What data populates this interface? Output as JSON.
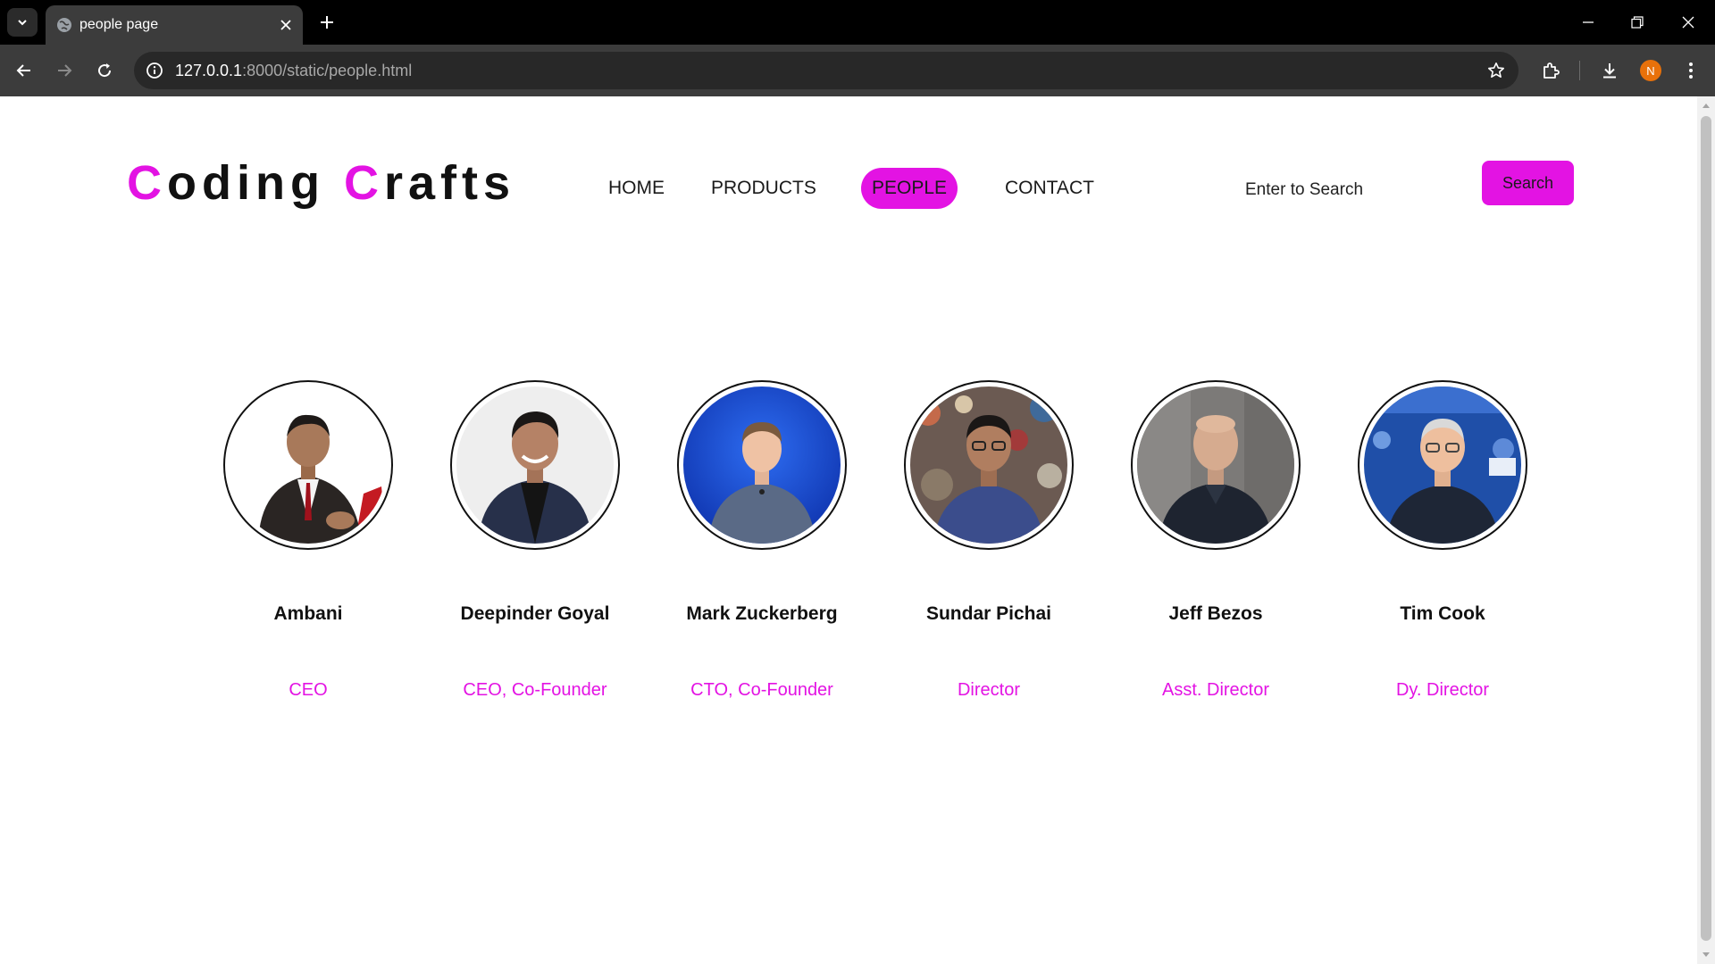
{
  "browser": {
    "tab_title": "people page",
    "url_host": "127.0.0.1",
    "url_rest": ":8000/static/people.html",
    "profile_initial": "N",
    "accent_color": "#e313e3"
  },
  "header": {
    "logo_c1": "C",
    "logo_w1": "oding",
    "logo_c2": "C",
    "logo_w2": "rafts"
  },
  "nav": {
    "items": [
      {
        "label": "HOME",
        "active": false
      },
      {
        "label": "PRODUCTS",
        "active": false
      },
      {
        "label": "PEOPLE",
        "active": true
      },
      {
        "label": "CONTACT",
        "active": false
      }
    ]
  },
  "search": {
    "placeholder": "Enter to Search",
    "button_label": "Search"
  },
  "people": [
    {
      "name": "Ambani",
      "role": "CEO"
    },
    {
      "name": "Deepinder Goyal",
      "role": "CEO, Co-Founder"
    },
    {
      "name": "Mark Zuckerberg",
      "role": "CTO, Co-Founder"
    },
    {
      "name": "Sundar Pichai",
      "role": "Director"
    },
    {
      "name": "Jeff Bezos",
      "role": "Asst. Director"
    },
    {
      "name": "Tim Cook",
      "role": "Dy. Director"
    }
  ]
}
